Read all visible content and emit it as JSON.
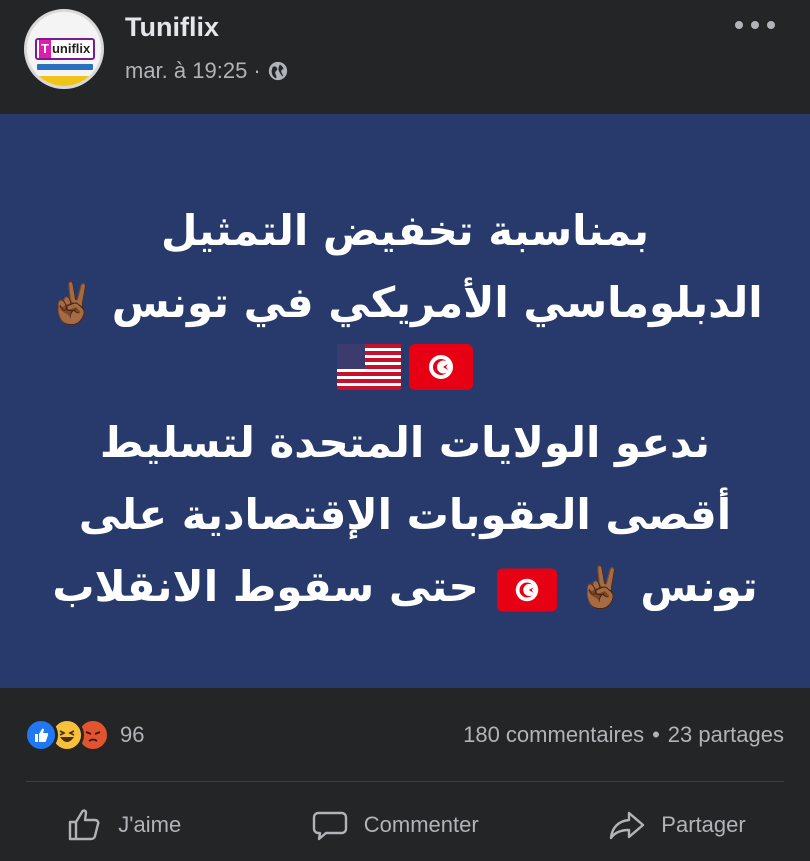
{
  "post": {
    "page_name": "Tuniflix",
    "avatar_text_t": "T",
    "avatar_text_rest": "uniflix",
    "timestamp": "mar. à 19:25",
    "meta_separator": "·",
    "privacy_icon": "globe-icon",
    "more_icon": "more-icon"
  },
  "image": {
    "background": "#273a6b",
    "line1": "بمناسبة تخفيض التمثيل",
    "line2": "الدبلوماسي الأمريكي في تونس",
    "line4": "ندعو الولايات المتحدة لتسليط",
    "line5": "أقصى العقوبات الإقتصادية على",
    "line6_start": "تونس",
    "line6_end": "حتى سقوط الانقلاب",
    "victory_emoji": "✌🏾",
    "flag_icons": [
      "tunisia-flag-icon",
      "usa-flag-icon"
    ]
  },
  "engagement": {
    "reaction_count": "96",
    "reaction_icons": [
      "like-reaction-icon",
      "haha-reaction-icon",
      "angry-reaction-icon"
    ],
    "comments": "180 commentaires",
    "separator": "•",
    "shares": "23 partages"
  },
  "actions": {
    "like_label": "J'aime",
    "comment_label": "Commenter",
    "share_label": "Partager"
  },
  "colors": {
    "background": "#242526",
    "post_image_bg": "#273a6b",
    "like_blue": "#2078f4",
    "haha_yellow": "#f7c13b",
    "angry_orange": "#e2532f"
  }
}
